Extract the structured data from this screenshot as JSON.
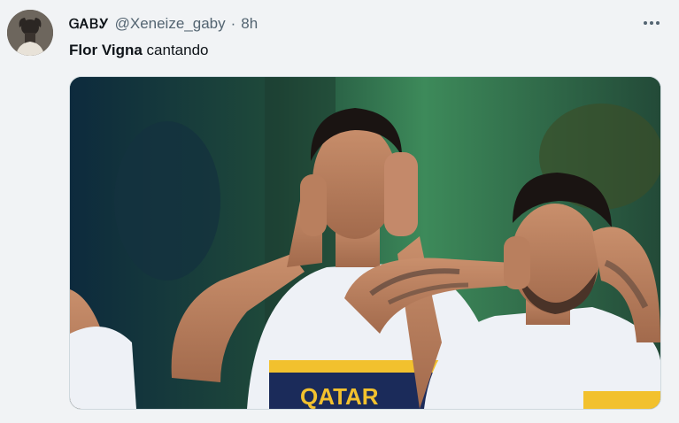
{
  "tweet": {
    "display_name": "ᏀᎪᏴᎩ",
    "handle": "@Xeneize_gaby",
    "separator": "·",
    "time": "8h",
    "text_bold": "Flor Vigna",
    "text_rest": " cantando",
    "shirt_text": "QATAR",
    "more_icon": "more-horizontal-icon"
  },
  "colors": {
    "text_primary": "#0f1419",
    "text_secondary": "#536471",
    "background": "#f1f3f5",
    "boca_blue": "#1b2b5a",
    "boca_gold": "#f2c12e"
  }
}
